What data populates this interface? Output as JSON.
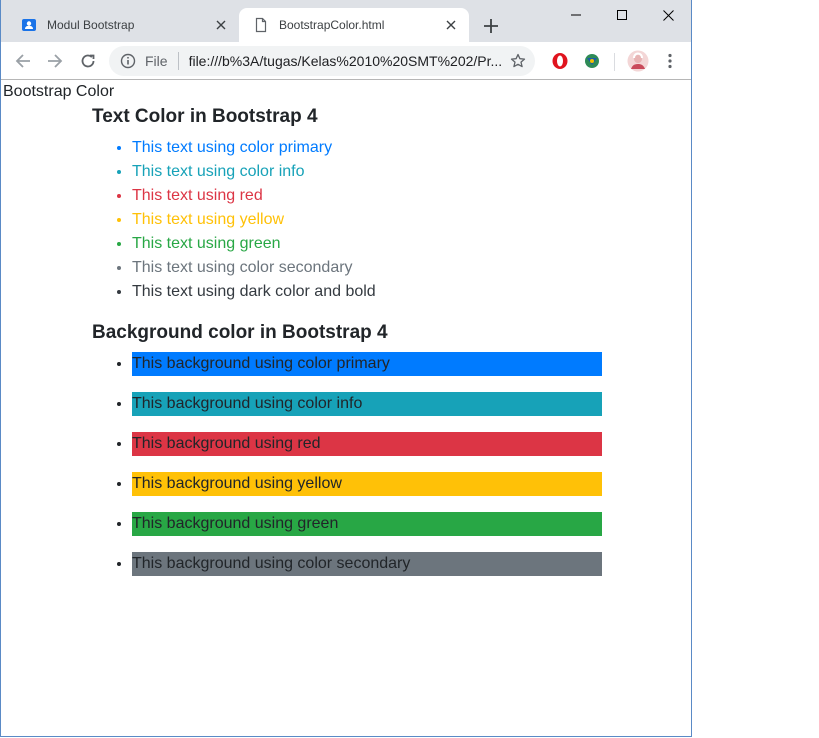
{
  "browser": {
    "tabs": [
      {
        "title": "Modul Bootstrap",
        "icon": "contact-card-icon",
        "active": false
      },
      {
        "title": "BootstrapColor.html",
        "icon": "file-icon",
        "active": true
      }
    ],
    "omnibox": {
      "scheme_label": "File",
      "url": "file:///b%3A/tugas/Kelas%2010%20SMT%202/Pr..."
    },
    "extensions": [
      "opera-icon",
      "idm-icon"
    ],
    "colors": {
      "tabstrip": "#dee1e6",
      "omnibox": "#f1f3f4",
      "window_border": "#5a8ac6"
    }
  },
  "page": {
    "doc_title": "Bootstrap Color",
    "text_section": {
      "heading": "Text Color in Bootstrap 4",
      "items": [
        {
          "text": "This text using color primary",
          "color": "#007bff"
        },
        {
          "text": "This text using color info",
          "color": "#17a2b8"
        },
        {
          "text": "This text using red",
          "color": "#dc3545"
        },
        {
          "text": "This text using yellow",
          "color": "#ffc107"
        },
        {
          "text": "This text using green",
          "color": "#28a745"
        },
        {
          "text": "This text using color secondary",
          "color": "#6c757d"
        },
        {
          "text": "This text using dark color and bold",
          "color": "#343a40"
        }
      ]
    },
    "bg_section": {
      "heading": "Background color in Bootstrap 4",
      "items": [
        {
          "text": "This background using color primary",
          "color": "#007bff"
        },
        {
          "text": "This background using color info",
          "color": "#17a2b8"
        },
        {
          "text": "This background using red",
          "color": "#dc3545"
        },
        {
          "text": "This background using yellow",
          "color": "#ffc107"
        },
        {
          "text": "This background using green",
          "color": "#28a745"
        },
        {
          "text": "This background using color secondary",
          "color": "#6c757d"
        }
      ]
    }
  }
}
